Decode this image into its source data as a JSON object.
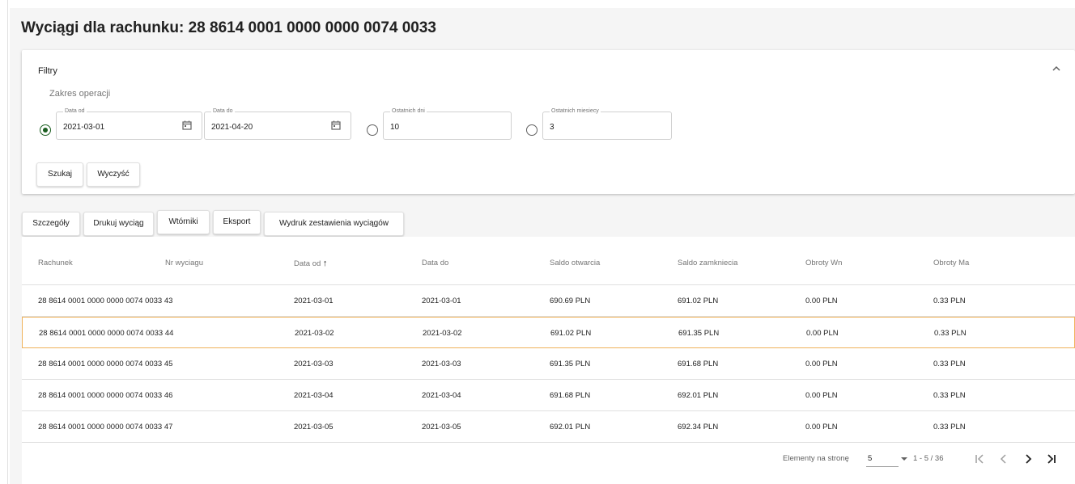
{
  "page": {
    "title": "Wyciągi dla rachunku: 28 8614 0001 0000 0000 0074 0033"
  },
  "filters": {
    "title": "Filtry",
    "range_label": "Zakres operacji",
    "date_from": {
      "label": "Data od",
      "value": "2021-03-01"
    },
    "date_to": {
      "label": "Data do",
      "value": "2021-04-20"
    },
    "last_days": {
      "label": "Ostatnich dni",
      "value": "10"
    },
    "last_months": {
      "label": "Ostatnich miesiecy",
      "value": "3"
    },
    "search_label": "Szukaj",
    "clear_label": "Wyczyść"
  },
  "toolbar": {
    "details": "Szczegóły",
    "print": "Drukuj wyciąg",
    "duplicates": "Wtórniki",
    "export": "Eksport",
    "summary_print": "Wydruk zestawienia wyciągów"
  },
  "table": {
    "columns": [
      "Rachunek",
      "Nr wyciagu",
      "Data od",
      "Data do",
      "Saldo otwarcia",
      "Saldo zamkniecia",
      "Obroty Wn",
      "Obroty Ma"
    ],
    "sort_indicator": "↑",
    "rows": [
      {
        "account": "28 8614 0001 0000 0000 0074 0033",
        "nr": "43",
        "from": "2021-03-01",
        "to": "2021-03-01",
        "open": "690.69 PLN",
        "close": "691.02 PLN",
        "wn": "0.00 PLN",
        "ma": "0.33 PLN"
      },
      {
        "account": "28 8614 0001 0000 0000 0074 0033",
        "nr": "44",
        "from": "2021-03-02",
        "to": "2021-03-02",
        "open": "691.02 PLN",
        "close": "691.35 PLN",
        "wn": "0.00 PLN",
        "ma": "0.33 PLN"
      },
      {
        "account": "28 8614 0001 0000 0000 0074 0033",
        "nr": "45",
        "from": "2021-03-03",
        "to": "2021-03-03",
        "open": "691.35 PLN",
        "close": "691.68 PLN",
        "wn": "0.00 PLN",
        "ma": "0.33 PLN"
      },
      {
        "account": "28 8614 0001 0000 0000 0074 0033",
        "nr": "46",
        "from": "2021-03-04",
        "to": "2021-03-04",
        "open": "691.68 PLN",
        "close": "692.01 PLN",
        "wn": "0.00 PLN",
        "ma": "0.33 PLN"
      },
      {
        "account": "28 8614 0001 0000 0000 0074 0033",
        "nr": "47",
        "from": "2021-03-05",
        "to": "2021-03-05",
        "open": "692.01 PLN",
        "close": "692.34 PLN",
        "wn": "0.00 PLN",
        "ma": "0.33 PLN"
      }
    ]
  },
  "paginator": {
    "items_per_page_label": "Elementy na stronę",
    "page_size": "5",
    "range": "1 - 5 / 36"
  },
  "colors": {
    "accent": "#1b5e20",
    "selected_border": "#f0b25a",
    "background": "#f5f5f5"
  }
}
